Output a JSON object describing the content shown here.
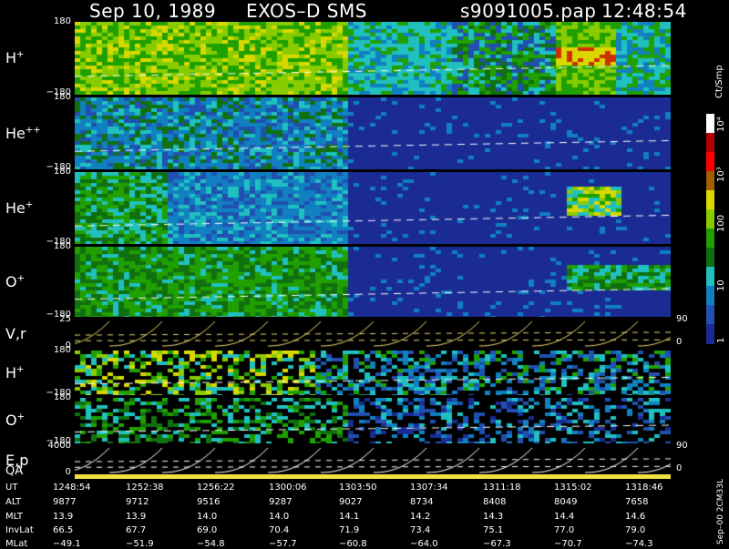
{
  "header": {
    "date": "Sep 10, 1989",
    "instrument": "EXOS–D SMS",
    "file": "s9091005.pap",
    "time": "12:48:54"
  },
  "panels": [
    {
      "id": "h",
      "label": "H",
      "sup": "+",
      "ytop": "180",
      "ybot": "−180"
    },
    {
      "id": "he2",
      "label": "He",
      "sup": "++",
      "ytop": "180",
      "ybot": "−180"
    },
    {
      "id": "he1",
      "label": "He",
      "sup": "+",
      "ytop": "180",
      "ybot": "−180"
    },
    {
      "id": "o",
      "label": "O",
      "sup": "+",
      "ytop": "180",
      "ybot": "−180"
    },
    {
      "id": "vr",
      "label": "V,r",
      "sup": "",
      "ytop": "25",
      "ybot": "0",
      "right_top": "90",
      "right_bot": "0"
    },
    {
      "id": "h2",
      "label": "H",
      "sup": "+",
      "ytop": "180",
      "ybot": "−180"
    },
    {
      "id": "o2",
      "label": "O",
      "sup": "+",
      "ytop": "180",
      "ybot": "−180"
    },
    {
      "id": "ep",
      "label": "E,p",
      "sup": "",
      "ytop": "4000",
      "ybot": "0",
      "right_top": "90",
      "right_bot": "0"
    }
  ],
  "qa_label": "QA",
  "colorbar": {
    "unit": "Ct/Smp",
    "ticks": [
      "10⁴",
      "10³",
      "100",
      "10",
      "1"
    ],
    "colors": [
      "#ffffff",
      "#b00000",
      "#ff0000",
      "#a06000",
      "#d8d800",
      "#88cc00",
      "#20a000",
      "#107010",
      "#20c0c0",
      "#1080c0",
      "#2050b0",
      "#1a2b94"
    ]
  },
  "chart_data": {
    "type": "heatmap",
    "title": "Sep 10, 1989   EXOS–D SMS",
    "rows": [
      "UT",
      "ALT",
      "MLT",
      "InvLat",
      "MLat"
    ],
    "ut": [
      "1248:54",
      "1252:38",
      "1256:22",
      "1300:06",
      "1303:50",
      "1307:34",
      "1311:18",
      "1315:02",
      "1318:46"
    ],
    "alt": [
      9877,
      9712,
      9516,
      9287,
      9027,
      8734,
      8408,
      8049,
      7658
    ],
    "mlt": [
      13.9,
      13.9,
      14.0,
      14.0,
      14.1,
      14.2,
      14.3,
      14.4,
      14.6
    ],
    "invlat": [
      66.5,
      67.7,
      69.0,
      70.4,
      71.9,
      73.4,
      75.1,
      77.0,
      79.0
    ],
    "mlat": [
      -49.1,
      -51.9,
      -54.8,
      -57.7,
      -60.8,
      -64.0,
      -67.3,
      -70.7,
      -74.3
    ],
    "color_scale_range": [
      1,
      10000
    ],
    "y_range_angle": [
      -180,
      180
    ]
  },
  "table_labels": [
    "UT",
    "ALT",
    "MLT",
    "InvLat",
    "MLat"
  ],
  "table_values": {
    "UT": [
      "1248:54",
      "1252:38",
      "1256:22",
      "1300:06",
      "1303:50",
      "1307:34",
      "1311:18",
      "1315:02",
      "1318:46"
    ],
    "ALT": [
      "9877",
      "9712",
      "9516",
      "9287",
      "9027",
      "8734",
      "8408",
      "8049",
      "7658"
    ],
    "MLT": [
      "13.9",
      "13.9",
      "14.0",
      "14.0",
      "14.1",
      "14.2",
      "14.3",
      "14.4",
      "14.6"
    ],
    "InvLat": [
      "66.5",
      "67.7",
      "69.0",
      "70.4",
      "71.9",
      "73.4",
      "75.1",
      "77.0",
      "79.0"
    ],
    "MLat": [
      "−49.1",
      "−51.9",
      "−54.8",
      "−57.7",
      "−60.8",
      "−64.0",
      "−67.3",
      "−70.7",
      "−74.3"
    ]
  },
  "footer_side": "Sep–00 2CM33L"
}
